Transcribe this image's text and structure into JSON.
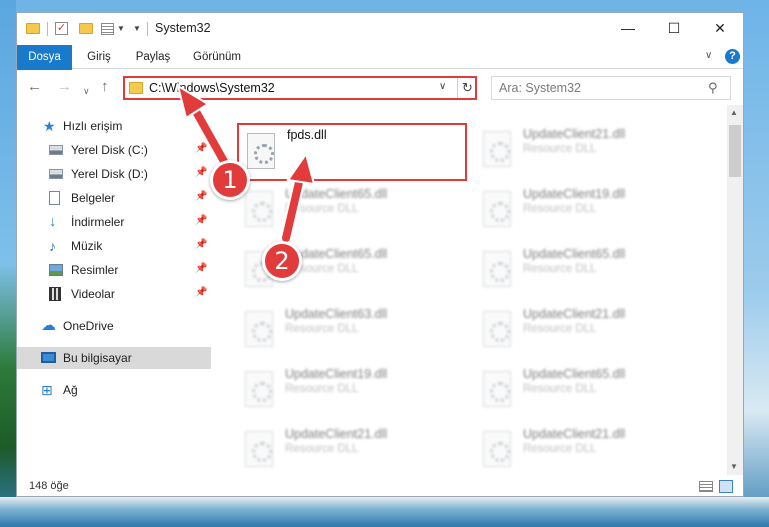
{
  "window": {
    "title": "System32",
    "minimize": "—",
    "maximize": "☐",
    "close": "✕"
  },
  "ribbon": {
    "tabs": [
      "Dosya",
      "Giriş",
      "Paylaş",
      "Görünüm"
    ]
  },
  "address_bar": {
    "path": "C:\\Windows\\System32"
  },
  "search": {
    "placeholder": "Ara: System32"
  },
  "sidebar": {
    "items": [
      {
        "label": "Hızlı erişim",
        "icon": "star-icon",
        "pinned": false
      },
      {
        "label": "Yerel Disk (C:)",
        "icon": "drive-icon",
        "pinned": true
      },
      {
        "label": "Yerel Disk (D:)",
        "icon": "drive-icon",
        "pinned": true
      },
      {
        "label": "Belgeler",
        "icon": "document-icon",
        "pinned": true
      },
      {
        "label": "İndirmeler",
        "icon": "download-icon",
        "pinned": true
      },
      {
        "label": "Müzik",
        "icon": "music-icon",
        "pinned": true
      },
      {
        "label": "Resimler",
        "icon": "pictures-icon",
        "pinned": true
      },
      {
        "label": "Videolar",
        "icon": "video-icon",
        "pinned": true
      },
      {
        "label": "OneDrive",
        "icon": "cloud-icon",
        "pinned": false
      },
      {
        "label": "Bu bilgisayar",
        "icon": "computer-icon",
        "pinned": false,
        "selected": true
      },
      {
        "label": "Ağ",
        "icon": "network-icon",
        "pinned": false
      }
    ]
  },
  "files": [
    {
      "name": "fpds.dll",
      "type": "",
      "highlighted": true
    },
    {
      "name": "UpdateClient21.dll",
      "type": "Resource DLL"
    },
    {
      "name": "UpdateClient65.dll",
      "type": "Resource DLL"
    },
    {
      "name": "UpdateClient19.dll",
      "type": "Resource DLL"
    },
    {
      "name": "UpdateClient65.dll",
      "type": "Resource DLL"
    },
    {
      "name": "UpdateClient65.dll",
      "type": "Resource DLL"
    },
    {
      "name": "UpdateClient63.dll",
      "type": "Resource DLL"
    },
    {
      "name": "UpdateClient21.dll",
      "type": "Resource DLL"
    },
    {
      "name": "UpdateClient19.dll",
      "type": "Resource DLL"
    },
    {
      "name": "UpdateClient65.dll",
      "type": "Resource DLL"
    },
    {
      "name": "UpdateClient21.dll",
      "type": "Resource DLL"
    },
    {
      "name": "UpdateClient21.dll",
      "type": "Resource DLL"
    }
  ],
  "status": {
    "item_count": "148 öğe"
  },
  "annotations": {
    "step1": "1",
    "step2": "2",
    "color": "#e23b3b"
  }
}
